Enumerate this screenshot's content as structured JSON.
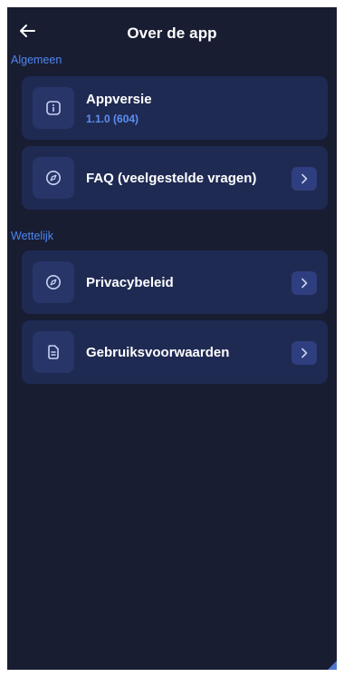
{
  "header": {
    "title": "Over de app",
    "back_icon": "arrow-left-icon"
  },
  "sections": {
    "general": {
      "title": "Algemeen",
      "items": [
        {
          "label": "Appversie",
          "value": "1.1.0 (604)",
          "icon": "info-icon"
        },
        {
          "label": "FAQ (veelgestelde vragen)",
          "icon": "compass-icon",
          "action_icon": "chevron-right-icon"
        }
      ]
    },
    "legal": {
      "title": "Wettelijk",
      "items": [
        {
          "label": "Privacybeleid",
          "icon": "compass-icon",
          "action_icon": "chevron-right-icon"
        },
        {
          "label": "Gebruiksvoorwaarden",
          "icon": "document-icon",
          "action_icon": "chevron-right-icon"
        }
      ]
    }
  },
  "colors": {
    "background": "#181d32",
    "card": "#1f2a53",
    "icon_box": "#273568",
    "chevron_box": "#2f3e7e",
    "accent": "#4e86ef",
    "text": "#ffffff"
  }
}
